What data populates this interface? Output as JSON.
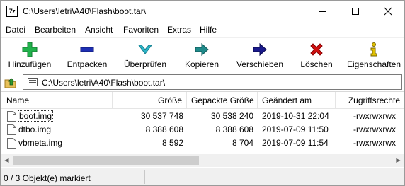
{
  "window": {
    "app_icon_text": "7z",
    "title": "C:\\Users\\letri\\A40\\Flash\\boot.tar\\",
    "minimize_icon": "minimize-icon",
    "maximize_icon": "maximize-icon",
    "close_icon": "close-icon"
  },
  "menu": {
    "items": [
      "Datei",
      "Bearbeiten",
      "Ansicht",
      "Favoriten",
      "Extras",
      "Hilfe"
    ]
  },
  "toolbar": {
    "buttons": [
      {
        "label": "Hinzufügen",
        "icon": "add-plus-icon",
        "color": "#22b14c"
      },
      {
        "label": "Entpacken",
        "icon": "extract-minus-icon",
        "color": "#1e2fb4"
      },
      {
        "label": "Überprüfen",
        "icon": "test-check-icon",
        "color": "#2bb5c8"
      },
      {
        "label": "Kopieren",
        "icon": "copy-arrow-icon",
        "color": "#1f8a8a"
      },
      {
        "label": "Verschieben",
        "icon": "move-arrow-icon",
        "color": "#1a1a8c"
      },
      {
        "label": "Löschen",
        "icon": "delete-x-icon",
        "color": "#d01010"
      },
      {
        "label": "Eigenschaften",
        "icon": "info-icon",
        "color": "#e0c000"
      }
    ]
  },
  "address": {
    "path": "C:\\Users\\letri\\A40\\Flash\\boot.tar\\"
  },
  "table": {
    "columns": [
      "Name",
      "Größe",
      "Gepackte Größe",
      "Geändert am",
      "Zugriffsrechte"
    ],
    "rows": [
      {
        "name": "boot.img",
        "size": "30 537 748",
        "packed": "30 538 240",
        "modified": "2019-10-31 22:04",
        "perms": "-rwxrwxrwx"
      },
      {
        "name": "dtbo.img",
        "size": "8 388 608",
        "packed": "8 388 608",
        "modified": "2019-07-09 11:50",
        "perms": "-rwxrwxrwx"
      },
      {
        "name": "vbmeta.img",
        "size": "8 592",
        "packed": "8 704",
        "modified": "2019-07-09 11:54",
        "perms": "-rwxrwxrwx"
      }
    ]
  },
  "status": {
    "text": "0 / 3 Objekt(e) markiert"
  }
}
